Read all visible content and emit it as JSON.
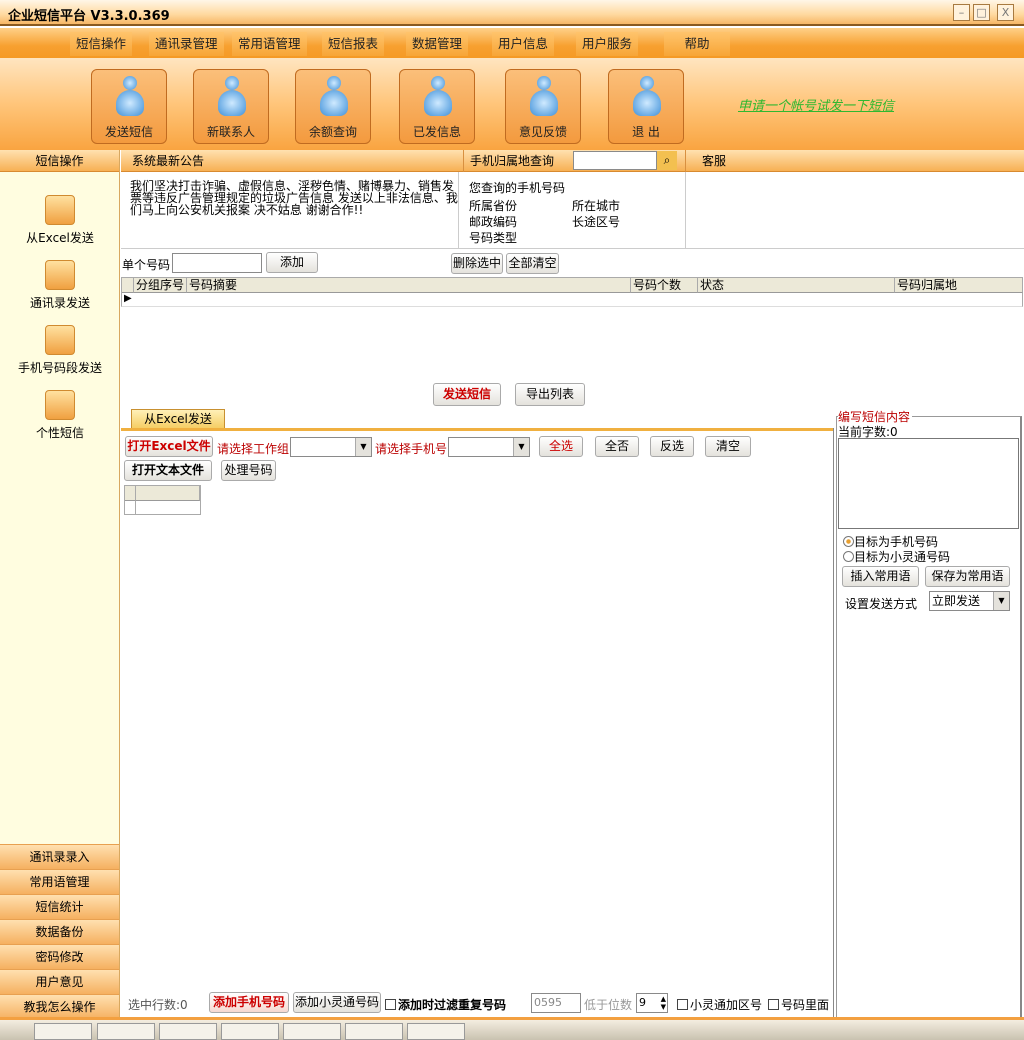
{
  "window": {
    "title": "企业短信平台 V3.3.0.369",
    "min": "–",
    "max": "□",
    "close": "X"
  },
  "menu": [
    "短信操作",
    "通讯录管理",
    "常用语管理",
    "短信报表",
    "数据管理",
    "用户信息",
    "用户服务",
    "帮助"
  ],
  "toolbar": [
    "发送短信",
    "新联系人",
    "余额查询",
    "已发信息",
    "意见反馈",
    "退 出"
  ],
  "trial_link": "申请一个帐号试发一下短信",
  "sidebar": {
    "header": "短信操作",
    "items": [
      "从Excel发送",
      "通讯录发送",
      "手机号码段发送",
      "个性短信"
    ],
    "bottom": [
      "通讯录录入",
      "常用语管理",
      "短信统计",
      "数据备份",
      "密码修改",
      "用户意见",
      "教我怎么操作"
    ]
  },
  "notice": {
    "header": "系统最新公告",
    "text": "我们坚决打击诈骗、虚假信息、淫秽色情、赌博暴力、销售发票等违反广告管理规定的垃圾广告信息 发送以上非法信息、我们马上向公安机关报案 决不姑息 谢谢合作!!"
  },
  "lookup": {
    "header": "手机归属地查询",
    "query_label": "您查询的手机号码",
    "province": "所属省份",
    "city": "所在城市",
    "postcode": "邮政编码",
    "areacode": "长途区号",
    "type": "号码类型"
  },
  "service": {
    "header": "客服"
  },
  "single": {
    "label": "单个号码",
    "value": "",
    "add": "添加",
    "delete": "删除选中",
    "clear": "全部清空"
  },
  "grid": {
    "columns": [
      "分组序号",
      "号码摘要",
      "号码个数",
      "状态",
      "号码归属地"
    ]
  },
  "actions": {
    "send": "发送短信",
    "export": "导出列表"
  },
  "tab": "从Excel发送",
  "excel": {
    "open_excel": "打开Excel文件",
    "group_label": "请选择工作组",
    "phone_label": "请选择手机号",
    "select_all": "全选",
    "select_none": "全否",
    "invert": "反选",
    "clear": "清空",
    "open_text": "打开文本文件",
    "process": "处理号码"
  },
  "compose": {
    "legend": "编写短信内容",
    "count_label": "当前字数:",
    "count": "0",
    "target_mobile": "目标为手机号码",
    "target_phs": "目标为小灵通号码",
    "insert": "插入常用语",
    "save": "保存为常用语",
    "mode_label": "设置发送方式",
    "mode": "立即发送"
  },
  "status": {
    "selected_label": "选中行数:",
    "selected": "0",
    "add_mobile": "添加手机号码",
    "add_phs": "添加小灵通号码",
    "filter_dup": "添加时过滤重复号码",
    "area_value": "0595",
    "digits_label": "低于位数",
    "digits": "9",
    "phs_area": "小灵通加区号",
    "inside": "号码里面"
  }
}
